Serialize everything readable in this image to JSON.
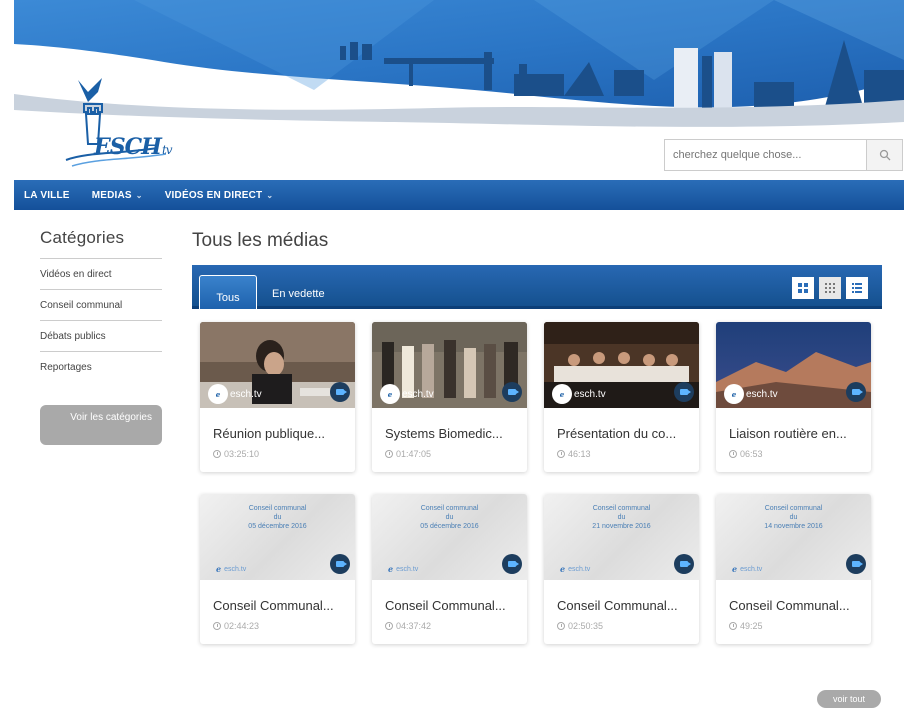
{
  "brand": {
    "logo_name": "ESCH",
    "logo_suffix": "tv"
  },
  "search": {
    "placeholder": "cherchez quelque chose..."
  },
  "nav": {
    "items": [
      "LA VILLE",
      "MEDIAS",
      "VIDÉOS EN DIRECT"
    ]
  },
  "sidebar": {
    "title": "Catégories",
    "items": [
      "Vidéos en direct",
      "Conseil communal",
      "Débats publics",
      "Reportages"
    ],
    "see_all": "Voir les catégories"
  },
  "main": {
    "title": "Tous les médias",
    "tabs": [
      "Tous",
      "En vedette"
    ],
    "watermark": "esch.tv",
    "cards": [
      {
        "title": "Réunion publique...",
        "duration": "03:25:10"
      },
      {
        "title": "Systems Biomedic...",
        "duration": "01:47:05"
      },
      {
        "title": "Présentation du co...",
        "duration": "46:13"
      },
      {
        "title": "Liaison routière en...",
        "duration": "06:53"
      },
      {
        "title": "Conseil Communal...",
        "duration": "02:44:23",
        "thumb_line1": "Conseil communal",
        "thumb_line2": "du",
        "thumb_line3": "05 décembre 2016"
      },
      {
        "title": "Conseil Communal...",
        "duration": "04:37:42",
        "thumb_line1": "Conseil communal",
        "thumb_line2": "du",
        "thumb_line3": "05 décembre 2016"
      },
      {
        "title": "Conseil Communal...",
        "duration": "02:50:35",
        "thumb_line1": "Conseil communal",
        "thumb_line2": "du",
        "thumb_line3": "21 novembre 2016"
      },
      {
        "title": "Conseil Communal...",
        "duration": "49:25",
        "thumb_line1": "Conseil communal",
        "thumb_line2": "du",
        "thumb_line3": "14 novembre 2016"
      }
    ],
    "see_all": "voir tout"
  },
  "colors": {
    "brand_blue": "#1a5fa6",
    "nav_blue": "#14509a",
    "camera_badge": "#1d3d5e"
  }
}
